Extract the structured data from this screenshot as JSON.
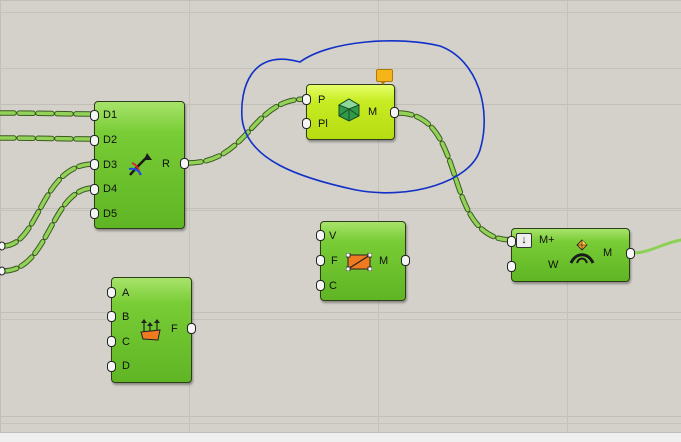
{
  "components": {
    "merge": {
      "inputs": [
        "D1",
        "D2",
        "D3",
        "D4",
        "D5"
      ],
      "outputs": [
        "R"
      ],
      "icon": "merge-arrows-icon"
    },
    "mesh": {
      "inputs": [
        "P",
        "Pl"
      ],
      "outputs": [
        "M"
      ],
      "icon": "polyhedron-mesh-icon",
      "warning_icon": "speech-bubble-warning-icon"
    },
    "mesh_face": {
      "inputs": [
        "V",
        "F",
        "C"
      ],
      "outputs": [
        "M"
      ],
      "icon": "quad-face-icon"
    },
    "face_tool": {
      "inputs": [
        "A",
        "B",
        "C",
        "D"
      ],
      "outputs": [
        "F"
      ],
      "icon": "face-arrows-icon"
    },
    "weave": {
      "inputs": [
        "M+",
        "W"
      ],
      "outputs": [
        "M"
      ],
      "icon": "weaver-icon",
      "collapse_icon": "down-arrow-icon"
    }
  },
  "colors": {
    "canvas": "#d4d1cb",
    "component": "#6cc22c",
    "selected_component": "#c8ec23",
    "wire": "#8ed055",
    "annotation": "#1030c8"
  }
}
